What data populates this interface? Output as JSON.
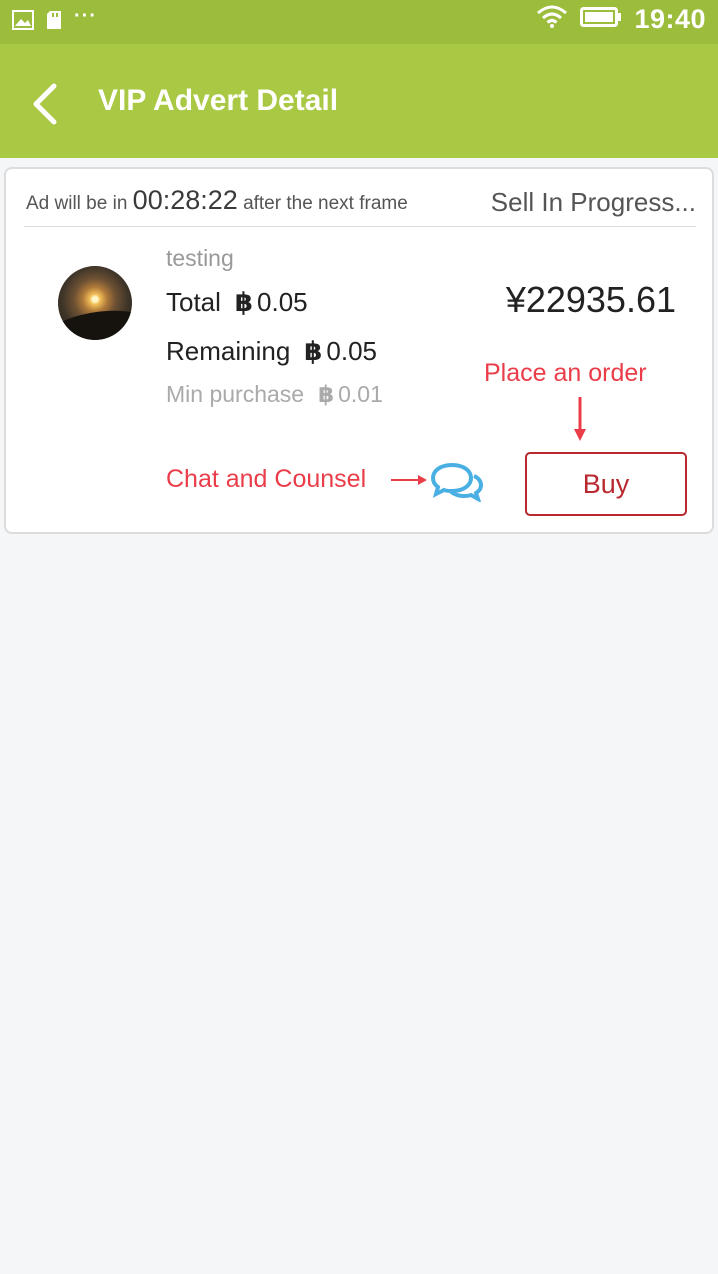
{
  "status_bar": {
    "time": "19:40",
    "dots": "···"
  },
  "app_bar": {
    "title": "VIP Advert Detail"
  },
  "ad": {
    "countdown_prefix": "Ad will be in",
    "countdown_time": "00:28:22",
    "countdown_suffix": "after the next frame",
    "status": "Sell In Progress...",
    "username": "testing",
    "total_label": "Total",
    "currency_symbol": "฿",
    "total_value": "0.05",
    "remaining_label": "Remaining",
    "remaining_value": "0.05",
    "min_purchase_label": "Min purchase",
    "min_purchase_value": "0.01",
    "price": "¥22935.61"
  },
  "annotations": {
    "place_order": "Place an order",
    "chat_counsel": "Chat and Counsel"
  },
  "actions": {
    "buy_label": "Buy"
  },
  "colors": {
    "status_bar": "#9cbc3c",
    "app_bar": "#a9c843",
    "annotation": "#ea3d49",
    "buy_button": "#b8282e",
    "chat_icon": "#4ab0e4"
  }
}
